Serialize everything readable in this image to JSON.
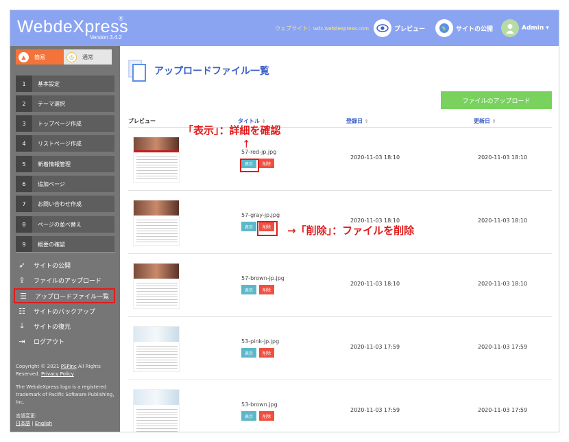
{
  "header": {
    "logo": "WebdeXpress",
    "logo_reg": "®",
    "version": "Version 3.4.2",
    "site_url": "ウェブサイト：wdx.webdexpress.com",
    "preview": "プレビュー",
    "publish": "サイトの公開",
    "user": "Admin",
    "user_caret": "▾"
  },
  "sidebar": {
    "modes": [
      {
        "label": "簡易",
        "active": true
      },
      {
        "label": "通常",
        "active": false
      }
    ],
    "steps": [
      {
        "num": "1",
        "label": "基本設定"
      },
      {
        "num": "2",
        "label": "テーマ選択"
      },
      {
        "num": "3",
        "label": "トップページ作成"
      },
      {
        "num": "4",
        "label": "リストページ作成"
      },
      {
        "num": "5",
        "label": "新着情報管理"
      },
      {
        "num": "6",
        "label": "追加ページ"
      },
      {
        "num": "7",
        "label": "お問い合わせ作成"
      },
      {
        "num": "8",
        "label": "ページの並べ替え"
      },
      {
        "num": "9",
        "label": "概要の確認"
      }
    ],
    "menu": [
      {
        "label": "サイトの公開",
        "icon": "rocket-icon"
      },
      {
        "label": "ファイルのアップロード",
        "icon": "upload-icon"
      },
      {
        "label": "アップロードファイル一覧",
        "icon": "list-icon"
      },
      {
        "label": "サイトのバックアップ",
        "icon": "backup-icon"
      },
      {
        "label": "サイトの復元",
        "icon": "download-icon"
      },
      {
        "label": "ログアウト",
        "icon": "logout-icon"
      }
    ],
    "footer": {
      "copyright": "Copyright © 2021",
      "company": "PSPinc",
      "rights": "All Rights Reserved.",
      "privacy": "Privacy Policy",
      "trademark": "The WebdeXpress logo is a registered trademark of Pacific Software Publishing, Inc.",
      "lang_label": "言語変更:",
      "lang_ja": "日本語",
      "lang_sep": "|",
      "lang_en": "English"
    }
  },
  "main": {
    "title": "アップロードファイル一覧",
    "upload_button": "ファイルのアップロード",
    "columns": {
      "preview": "プレビュー",
      "title": "タイトル",
      "registered": "登録日",
      "updated": "更新日"
    },
    "sort_icon": "⇕",
    "view_label": "表示",
    "delete_label": "削除",
    "rows": [
      {
        "name": "57-red-jp.jpg",
        "registered": "2020-11-03 18:10",
        "updated": "2020-11-03 18:10",
        "thumb": "red"
      },
      {
        "name": "57-gray-jp.jpg",
        "registered": "2020-11-03 18:10",
        "updated": "2020-11-03 18:10",
        "thumb": "gray"
      },
      {
        "name": "57-brown-jp.jpg",
        "registered": "2020-11-03 18:10",
        "updated": "2020-11-03 18:10",
        "thumb": "brown"
      },
      {
        "name": "53-pink-jp.jpg",
        "registered": "2020-11-03 17:59",
        "updated": "2020-11-03 17:59",
        "thumb": "light"
      },
      {
        "name": "53-brown.jpg",
        "registered": "2020-11-03 17:59",
        "updated": "2020-11-03 17:59",
        "thumb": "light"
      }
    ]
  },
  "annotations": {
    "view_note": "「表示」：詳細を確認",
    "delete_note": "→「削除」：ファイルを削除",
    "up_arrow": "↑"
  },
  "colors": {
    "header": "#8aa4f2",
    "accent": "#3b5fc8",
    "annotation": "#e01b1b",
    "upload": "#78d25d"
  }
}
